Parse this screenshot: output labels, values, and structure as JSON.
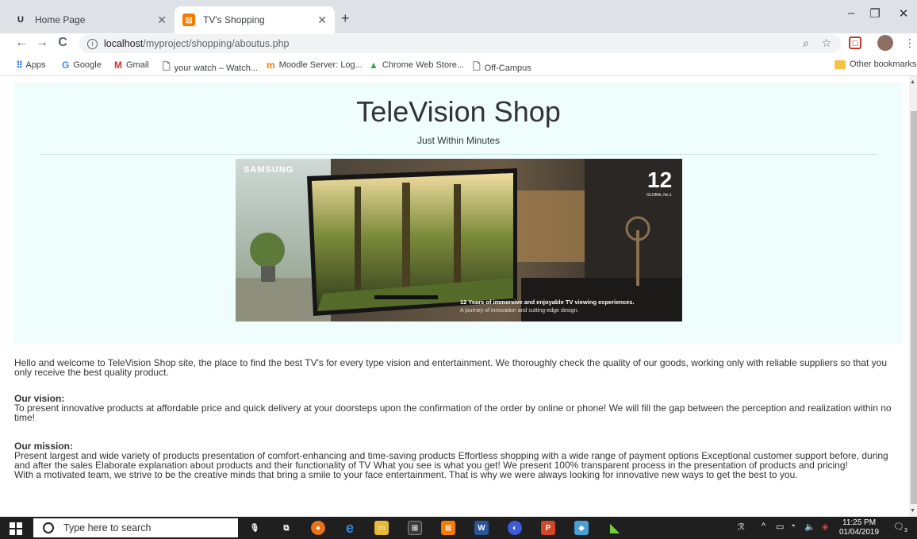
{
  "browser": {
    "tabs": [
      {
        "label": "Home Page",
        "active": false,
        "icon": "u-logo-icon"
      },
      {
        "label": "TV's Shopping",
        "active": true,
        "icon": "shop-icon"
      }
    ],
    "new_tab": "+",
    "window_controls": {
      "minimize": "–",
      "maximize": "❐",
      "close": "✕"
    },
    "nav": {
      "back": "←",
      "forward": "→",
      "reload": "C"
    },
    "url": {
      "host": "localhost",
      "path": "/myproject/shopping/aboutus.php"
    },
    "bookmarks": [
      {
        "label": "Apps",
        "icon": "apps-icon"
      },
      {
        "label": "Google",
        "icon": "google-icon"
      },
      {
        "label": "Gmail",
        "icon": "gmail-icon"
      },
      {
        "label": "your watch – Watch...",
        "icon": "page-icon"
      },
      {
        "label": "Moodle Server: Log...",
        "icon": "moodle-icon"
      },
      {
        "label": "Chrome Web Store...",
        "icon": "chrome-store-icon"
      },
      {
        "label": "Off-Campus",
        "icon": "page-icon"
      }
    ],
    "other_bookmarks": "Other bookmarks"
  },
  "page": {
    "title": "TeleVision Shop",
    "subtitle": "Just Within Minutes",
    "banner": {
      "brand": "SAMSUNG",
      "badge_number": "12",
      "badge_line": "GLOBAL No.1",
      "caption_main": "12 Years of immersive and enjoyable TV viewing experiences.",
      "caption_sub": "A journey of innovation and cutting-edge design."
    },
    "intro": "Hello and welcome to TeleVision Shop site, the place to find the best TV's for every type vision and entertainment. We thoroughly check the quality of our goods, working only with reliable suppliers so that you only receive the best quality product.",
    "vision_heading": "Our vision:",
    "vision_text": "To present innovative products at affordable price and quick delivery at your doorsteps upon the confirmation of the order by online or phone! We will fill the gap between the perception and realization within no time!",
    "mission_heading": "Our mission:",
    "mission_text": "Present largest and wide variety of products presentation of comfort-enhancing and time-saving products Effortless shopping with a wide range of payment options Exceptional customer support before, during and after the sales Elaborate explanation about products and their functionality of TV What you see is what you get! We present 100% transparent process in the presentation of products and pricing!",
    "team_text": "With a motivated team, we strive to be the creative minds that bring a smile to your face entertainment. That is why we were always looking for innovative new ways to get the best to you."
  },
  "taskbar": {
    "search_placeholder": "Type here to search",
    "time": "11:25 PM",
    "date": "01/04/2019",
    "notification_count": "3"
  },
  "colors": {
    "jumbotron_bg": "#f0fdfd",
    "tab_bar_bg": "#dee1e6",
    "taskbar_bg": "#1f1f1f"
  }
}
